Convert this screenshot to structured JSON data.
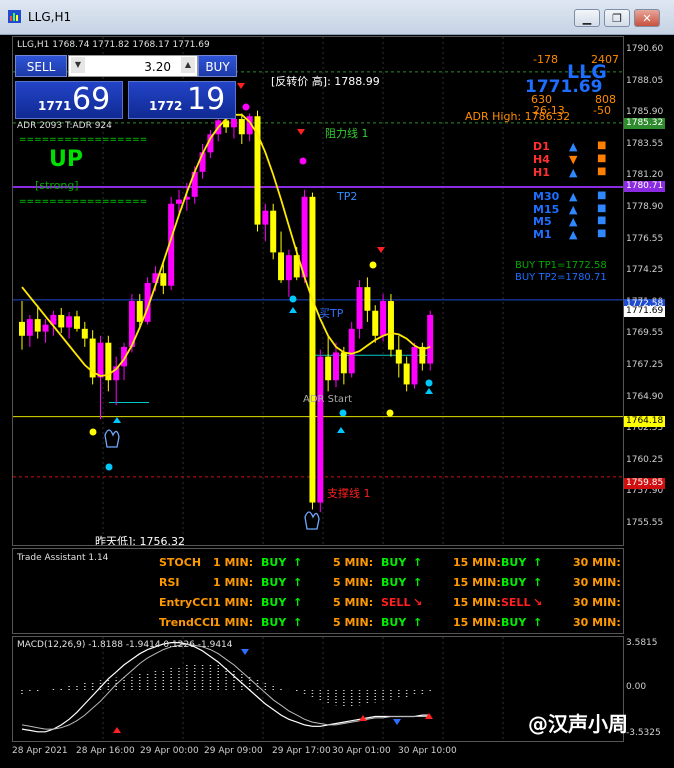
{
  "window": {
    "title": "LLG,H1"
  },
  "chart": {
    "header": "LLG,H1  1768.74 1771.82 1768.17 1771.69",
    "reversal_label": "[反转价 高]: 1788.99",
    "yesterday_low_label": "昨天低]: 1756.32",
    "resistance_label": "阻力线 1",
    "support_label": "支撑线 1",
    "tp2_label": "TP2",
    "tp1_label": "买TP",
    "adr_start_label": "ADR Start",
    "adr_label": "ADR 2093  T:ADR 924",
    "trend_word": "UP",
    "trend_strength": "[strong]",
    "trend_divider": "=================",
    "info": {
      "symbol": "LLG",
      "price": "1771.69",
      "val_minus178": "-178",
      "val_2407": "2407",
      "val_630": "630",
      "val_808": "808",
      "val_2613": "26:13",
      "val_minus50": "-50",
      "adr_high": "ADR High: 1786.32"
    },
    "timeframes": [
      {
        "tf": "D1",
        "dir": "▲",
        "dir_color": "#2f88ff",
        "sq_color": "#ff7f00"
      },
      {
        "tf": "H4",
        "dir": "▼",
        "dir_color": "#ff7f00",
        "sq_color": "#ff7f00"
      },
      {
        "tf": "H1",
        "dir": "▲",
        "dir_color": "#2f88ff",
        "sq_color": "#ff7f00"
      },
      {
        "tf": "M30",
        "dir": "▲",
        "dir_color": "#2f88ff",
        "sq_color": "#2f88ff"
      },
      {
        "tf": "M15",
        "dir": "▲",
        "dir_color": "#2f88ff",
        "sq_color": "#2f88ff"
      },
      {
        "tf": "M5",
        "dir": "▲",
        "dir_color": "#2f88ff",
        "sq_color": "#2f88ff"
      },
      {
        "tf": "M1",
        "dir": "▲",
        "dir_color": "#2f88ff",
        "sq_color": "#2f88ff"
      }
    ],
    "buy_tp1": "BUY  TP1=1772.58",
    "buy_tp2": "BUY  TP2=1780.71"
  },
  "ticket": {
    "sell_label": "SELL",
    "buy_label": "BUY",
    "lot": "3.20",
    "bid_small": "1771",
    "bid_big": "69",
    "ask_small": "1772",
    "ask_big": "19"
  },
  "price_axis": {
    "ticks": [
      "1790.60",
      "1788.05",
      "1785.90",
      "1783.55",
      "1781.20",
      "1778.90",
      "1776.55",
      "1774.25",
      "1771.90",
      "1769.55",
      "1767.25",
      "1764.90",
      "1762.55",
      "1760.25",
      "1757.90",
      "1755.55"
    ],
    "tags": [
      {
        "text": "1785.32",
        "bg": "#2e8b2e",
        "color": "#ffffff"
      },
      {
        "text": "1780.71",
        "bg": "#8a2be2",
        "color": "#ffffff"
      },
      {
        "text": "1772.58",
        "bg": "#1f4bd1",
        "color": "#ffffff"
      },
      {
        "text": "1771.69",
        "bg": "#ffffff",
        "color": "#000000"
      },
      {
        "text": "1764.18",
        "bg": "#ffff00",
        "color": "#000000"
      },
      {
        "text": "1759.85",
        "bg": "#d01010",
        "color": "#ffffff"
      }
    ],
    "macd_ticks": [
      "3.5815",
      "0.00",
      "-3.5325"
    ]
  },
  "trade_assistant": {
    "title": "Trade Assistant 1.14",
    "rows": [
      {
        "name": "STOCH",
        "c1": "BUY",
        "c1a": "↑",
        "c2": "BUY",
        "c2a": "↑",
        "c3": "BUY",
        "c3a": "↑"
      },
      {
        "name": "RSI",
        "c1": "BUY",
        "c1a": "↑",
        "c2": "BUY",
        "c2a": "↑",
        "c3": "BUY",
        "c3a": "↑"
      },
      {
        "name": "EntryCCI",
        "c1": "BUY",
        "c1a": "↑",
        "c2": "SELL",
        "c2a": "↘",
        "c3": "SELL",
        "c3a": "↘"
      },
      {
        "name": "TrendCCI",
        "c1": "BUY",
        "c1a": "↑",
        "c2": "BUY",
        "c2a": "↑",
        "c3": "BUY",
        "c3a": "↑"
      }
    ],
    "tf1": "1 MIN:",
    "tf5": "5 MIN:",
    "tf15": "15 MIN:",
    "tf30": "30 MIN:"
  },
  "macd": {
    "label": "MACD(12,26,9) -1.8188 -1.9414 0.1226 -1.9414"
  },
  "time_axis": [
    "28 Apr 2021",
    "28 Apr 16:00",
    "29 Apr 00:00",
    "29 Apr 09:00",
    "29 Apr 17:00",
    "30 Apr 01:00",
    "30 Apr 10:00"
  ],
  "watermark": "@汉声小周",
  "candles": [
    {
      "o": 1771.0,
      "h": 1772.5,
      "l": 1769.0,
      "c": 1770.0
    },
    {
      "o": 1770.0,
      "h": 1771.5,
      "l": 1769.2,
      "c": 1771.2
    },
    {
      "o": 1771.2,
      "h": 1772.2,
      "l": 1769.8,
      "c": 1770.3
    },
    {
      "o": 1770.3,
      "h": 1771.2,
      "l": 1769.5,
      "c": 1770.8
    },
    {
      "o": 1770.8,
      "h": 1771.8,
      "l": 1770.0,
      "c": 1771.5
    },
    {
      "o": 1771.5,
      "h": 1772.0,
      "l": 1770.2,
      "c": 1770.6
    },
    {
      "o": 1770.6,
      "h": 1771.7,
      "l": 1769.8,
      "c": 1771.4
    },
    {
      "o": 1771.4,
      "h": 1771.8,
      "l": 1770.3,
      "c": 1770.5
    },
    {
      "o": 1770.5,
      "h": 1771.0,
      "l": 1769.2,
      "c": 1769.8
    },
    {
      "o": 1769.8,
      "h": 1770.4,
      "l": 1766.5,
      "c": 1767.0
    },
    {
      "o": 1767.0,
      "h": 1770.0,
      "l": 1764.0,
      "c": 1769.5
    },
    {
      "o": 1769.5,
      "h": 1770.0,
      "l": 1766.0,
      "c": 1766.8
    },
    {
      "o": 1766.8,
      "h": 1768.5,
      "l": 1765.0,
      "c": 1767.8
    },
    {
      "o": 1767.8,
      "h": 1769.5,
      "l": 1766.8,
      "c": 1769.2
    },
    {
      "o": 1769.2,
      "h": 1773.0,
      "l": 1768.8,
      "c": 1772.5
    },
    {
      "o": 1772.5,
      "h": 1773.0,
      "l": 1770.5,
      "c": 1771.0
    },
    {
      "o": 1771.0,
      "h": 1774.2,
      "l": 1770.8,
      "c": 1773.8
    },
    {
      "o": 1773.8,
      "h": 1775.0,
      "l": 1773.2,
      "c": 1774.5
    },
    {
      "o": 1774.5,
      "h": 1775.2,
      "l": 1773.0,
      "c": 1773.6
    },
    {
      "o": 1773.6,
      "h": 1780.0,
      "l": 1773.3,
      "c": 1779.5
    },
    {
      "o": 1779.5,
      "h": 1780.5,
      "l": 1778.8,
      "c": 1779.8
    },
    {
      "o": 1779.8,
      "h": 1781.0,
      "l": 1779.0,
      "c": 1780.0
    },
    {
      "o": 1780.0,
      "h": 1782.2,
      "l": 1779.5,
      "c": 1781.8
    },
    {
      "o": 1781.8,
      "h": 1783.8,
      "l": 1781.3,
      "c": 1783.2
    },
    {
      "o": 1783.2,
      "h": 1784.8,
      "l": 1782.8,
      "c": 1784.5
    },
    {
      "o": 1784.5,
      "h": 1786.0,
      "l": 1784.0,
      "c": 1785.5
    },
    {
      "o": 1785.5,
      "h": 1786.2,
      "l": 1784.6,
      "c": 1785.0
    },
    {
      "o": 1785.0,
      "h": 1786.3,
      "l": 1784.2,
      "c": 1785.6
    },
    {
      "o": 1785.6,
      "h": 1786.0,
      "l": 1783.8,
      "c": 1784.5
    },
    {
      "o": 1784.5,
      "h": 1786.0,
      "l": 1784.0,
      "c": 1785.8
    },
    {
      "o": 1785.8,
      "h": 1786.2,
      "l": 1777.5,
      "c": 1778.0
    },
    {
      "o": 1778.0,
      "h": 1779.5,
      "l": 1776.8,
      "c": 1779.0
    },
    {
      "o": 1779.0,
      "h": 1779.5,
      "l": 1775.5,
      "c": 1776.0
    },
    {
      "o": 1776.0,
      "h": 1777.5,
      "l": 1773.8,
      "c": 1774.0
    },
    {
      "o": 1774.0,
      "h": 1776.2,
      "l": 1772.8,
      "c": 1775.8
    },
    {
      "o": 1775.8,
      "h": 1776.4,
      "l": 1774.0,
      "c": 1774.2
    },
    {
      "o": 1774.2,
      "h": 1780.5,
      "l": 1773.8,
      "c": 1780.0
    },
    {
      "o": 1780.0,
      "h": 1780.3,
      "l": 1757.5,
      "c": 1758.0
    },
    {
      "o": 1758.0,
      "h": 1769.0,
      "l": 1757.3,
      "c": 1768.5
    },
    {
      "o": 1768.5,
      "h": 1770.0,
      "l": 1766.0,
      "c": 1766.8
    },
    {
      "o": 1766.8,
      "h": 1769.5,
      "l": 1766.3,
      "c": 1768.8
    },
    {
      "o": 1768.8,
      "h": 1769.2,
      "l": 1766.5,
      "c": 1767.3
    },
    {
      "o": 1767.3,
      "h": 1771.0,
      "l": 1767.0,
      "c": 1770.5
    },
    {
      "o": 1770.5,
      "h": 1774.0,
      "l": 1769.8,
      "c": 1773.5
    },
    {
      "o": 1773.5,
      "h": 1774.2,
      "l": 1771.0,
      "c": 1771.8
    },
    {
      "o": 1771.8,
      "h": 1772.2,
      "l": 1769.5,
      "c": 1770.0
    },
    {
      "o": 1770.0,
      "h": 1773.0,
      "l": 1769.6,
      "c": 1772.5
    },
    {
      "o": 1772.5,
      "h": 1773.0,
      "l": 1768.5,
      "c": 1769.0
    },
    {
      "o": 1769.0,
      "h": 1770.0,
      "l": 1767.0,
      "c": 1768.0
    },
    {
      "o": 1768.0,
      "h": 1768.5,
      "l": 1766.0,
      "c": 1766.5
    },
    {
      "o": 1766.5,
      "h": 1769.5,
      "l": 1766.2,
      "c": 1769.2
    },
    {
      "o": 1769.2,
      "h": 1769.5,
      "l": 1767.5,
      "c": 1768.0
    },
    {
      "o": 1768.0,
      "h": 1771.8,
      "l": 1767.5,
      "c": 1771.5
    }
  ],
  "ma_line": [
    1773.5,
    1772.8,
    1772.1,
    1771.4,
    1770.7,
    1770.0,
    1769.3,
    1768.6,
    1767.9,
    1767.4,
    1767.1,
    1767.2,
    1767.6,
    1768.3,
    1769.3,
    1770.6,
    1772.0,
    1773.6,
    1775.3,
    1777.0,
    1778.7,
    1780.3,
    1781.8,
    1783.1,
    1784.2,
    1785.0,
    1785.6,
    1785.9,
    1785.9,
    1785.4,
    1784.5,
    1783.2,
    1781.6,
    1779.8,
    1777.9,
    1776.0,
    1774.2,
    1772.6,
    1771.2,
    1770.0,
    1769.2,
    1768.8,
    1768.7,
    1768.9,
    1769.3,
    1769.7,
    1770.0,
    1770.2,
    1770.1,
    1769.8,
    1769.3,
    1769.0,
    1769.2
  ],
  "macd_hist": [
    -0.3,
    -0.2,
    -0.1,
    0.0,
    0.1,
    0.2,
    0.3,
    0.4,
    0.5,
    0.6,
    0.7,
    0.8,
    0.9,
    1.0,
    1.1,
    1.2,
    1.3,
    1.4,
    1.5,
    1.6,
    1.7,
    1.8,
    1.9,
    1.9,
    1.9,
    1.8,
    1.6,
    1.4,
    1.2,
    1.0,
    0.8,
    0.6,
    0.4,
    0.2,
    0.0,
    -0.2,
    -0.4,
    -0.6,
    -0.8,
    -1.0,
    -1.1,
    -1.2,
    -1.2,
    -1.1,
    -1.0,
    -0.9,
    -0.8,
    -0.7,
    -0.6,
    -0.5,
    -0.4,
    -0.3,
    -0.2
  ],
  "macd_line": [
    -2.8,
    -2.9,
    -3.0,
    -3.0,
    -2.8,
    -2.5,
    -2.1,
    -1.6,
    -1.0,
    -0.4,
    0.2,
    0.8,
    1.3,
    1.8,
    2.2,
    2.6,
    2.9,
    3.1,
    3.3,
    3.4,
    3.4,
    3.3,
    3.1,
    2.8,
    2.4,
    2.0,
    1.5,
    1.0,
    0.5,
    0.0,
    -0.5,
    -1.0,
    -1.4,
    -1.8,
    -2.1,
    -2.3,
    -2.5,
    -2.6,
    -2.6,
    -2.5,
    -2.4,
    -2.3,
    -2.2,
    -2.1,
    -2.0,
    -1.9,
    -1.9,
    -1.9,
    -1.9,
    -1.9,
    -1.9,
    -1.8,
    -1.8
  ],
  "macd_signal": [
    -2.5,
    -2.6,
    -2.7,
    -2.8,
    -2.8,
    -2.7,
    -2.5,
    -2.2,
    -1.8,
    -1.3,
    -0.8,
    -0.2,
    0.4,
    0.9,
    1.4,
    1.9,
    2.3,
    2.6,
    2.9,
    3.1,
    3.2,
    3.3,
    3.2,
    3.1,
    2.9,
    2.6,
    2.2,
    1.8,
    1.3,
    0.8,
    0.3,
    -0.2,
    -0.7,
    -1.1,
    -1.5,
    -1.8,
    -2.1,
    -2.3,
    -2.4,
    -2.5,
    -2.5,
    -2.4,
    -2.3,
    -2.2,
    -2.1,
    -2.0,
    -2.0,
    -1.9,
    -1.9,
    -1.9,
    -1.9,
    -1.9,
    -1.9
  ]
}
